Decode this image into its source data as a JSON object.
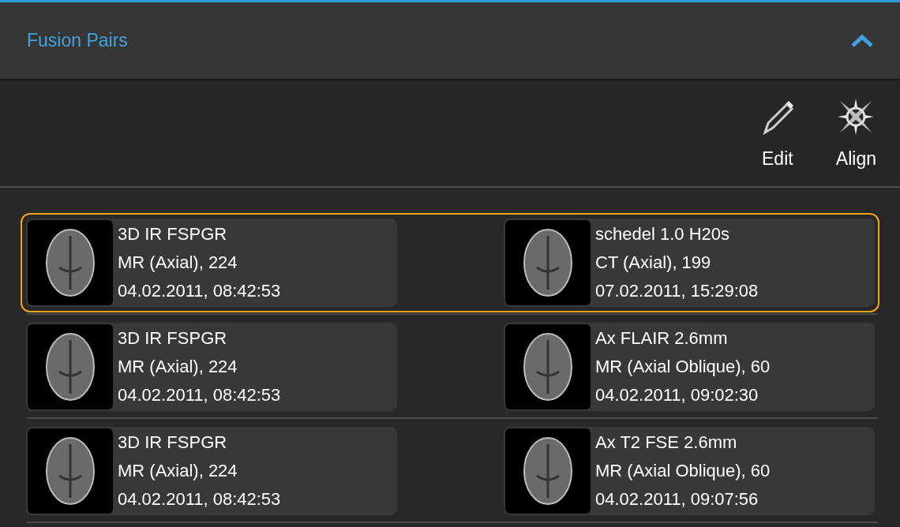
{
  "panel": {
    "title": "Fusion Pairs",
    "expanded": true
  },
  "toolbar": [
    {
      "kind": "edit",
      "label": "Edit"
    },
    {
      "kind": "align",
      "label": "Align"
    }
  ],
  "pairs": [
    {
      "selected": true,
      "series": [
        {
          "name": "3D IR FSPGR",
          "modality": "MR (Axial), 224",
          "datetime": "04.02.2011, 08:42:53"
        },
        {
          "name": "schedel 1.0 H20s",
          "modality": "CT (Axial), 199",
          "datetime": "07.02.2011, 15:29:08"
        }
      ]
    },
    {
      "selected": false,
      "series": [
        {
          "name": "3D IR FSPGR",
          "modality": "MR (Axial), 224",
          "datetime": "04.02.2011, 08:42:53"
        },
        {
          "name": "Ax FLAIR 2.6mm",
          "modality": "MR (Axial Oblique), 60",
          "datetime": "04.02.2011, 09:02:30"
        }
      ]
    },
    {
      "selected": false,
      "series": [
        {
          "name": "3D IR FSPGR",
          "modality": "MR (Axial), 224",
          "datetime": "04.02.2011, 08:42:53"
        },
        {
          "name": "Ax T2 FSE 2.6mm",
          "modality": "MR (Axial Oblique), 60",
          "datetime": "04.02.2011, 09:07:56"
        }
      ]
    }
  ]
}
